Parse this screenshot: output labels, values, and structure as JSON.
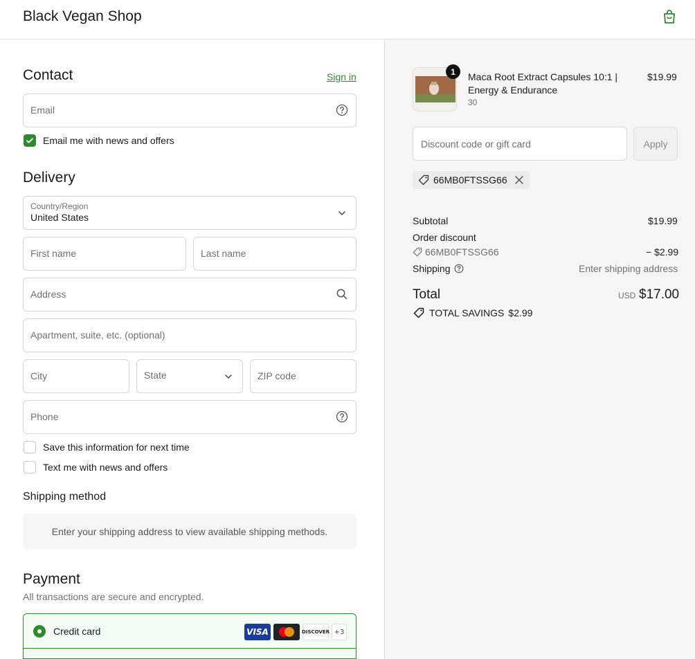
{
  "header": {
    "shop_name": "Black Vegan Shop",
    "cart_icon": "shopping-bag-icon"
  },
  "contact": {
    "title": "Contact",
    "sign_in": "Sign in",
    "email_placeholder": "Email",
    "email_news_label": "Email me with news and offers",
    "email_news_checked": true
  },
  "delivery": {
    "title": "Delivery",
    "country_label": "Country/Region",
    "country_value": "United States",
    "first_name_placeholder": "First name",
    "last_name_placeholder": "Last name",
    "address_placeholder": "Address",
    "apartment_placeholder": "Apartment, suite, etc. (optional)",
    "city_placeholder": "City",
    "state_placeholder": "State",
    "zip_placeholder": "ZIP code",
    "phone_placeholder": "Phone",
    "save_info_label": "Save this information for next time",
    "text_news_label": "Text me with news and offers"
  },
  "shipping_method": {
    "title": "Shipping method",
    "placeholder_text": "Enter your shipping address to view available shipping methods."
  },
  "payment": {
    "title": "Payment",
    "subtitle": "All transactions are secure and encrypted.",
    "method_label": "Credit card",
    "cards": [
      "VISA",
      "DISCOVER"
    ],
    "more_cards": "+3"
  },
  "order": {
    "item": {
      "name_line1": "Maca Root Extract Capsules 10:1 |",
      "name_line2": "Energy & Endurance",
      "variant": "30",
      "price": "$19.99",
      "quantity": "1"
    },
    "discount_placeholder": "Discount code or gift card",
    "apply_label": "Apply",
    "applied_code": "66MB0FTSSG66",
    "subtotal_label": "Subtotal",
    "subtotal_value": "$19.99",
    "order_discount_label": "Order discount",
    "discount_code": "66MB0FTSSG66",
    "discount_value": "− $2.99",
    "shipping_label": "Shipping",
    "shipping_value": "Enter shipping address",
    "total_label": "Total",
    "currency": "USD",
    "total_value": "$17.00",
    "savings_label": "TOTAL SAVINGS",
    "savings_value": "$2.99"
  },
  "colors": {
    "accent": "#2f8a2f",
    "border": "#d6d6d6",
    "summary_bg": "#f5f5f5"
  }
}
